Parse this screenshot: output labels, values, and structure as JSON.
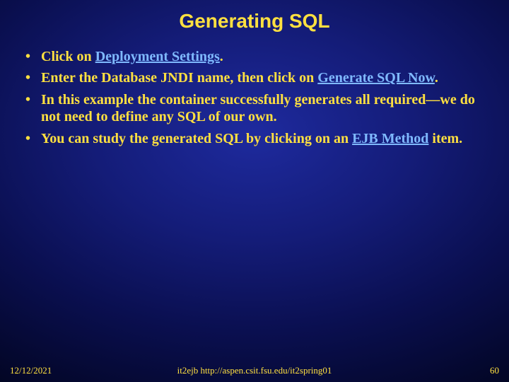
{
  "title": "Generating SQL",
  "bullets": {
    "b1_pre": "Click on ",
    "b1_link": "Deployment Settings",
    "b1_post": ".",
    "b2_pre": "Enter the Database JNDI name, then click on ",
    "b2_link": "Generate SQL Now",
    "b2_post": ".",
    "b3": "In this example the container successfully generates all required—we do not need to define any SQL of our own.",
    "b4_pre": "You can study the generated SQL by clicking on an ",
    "b4_link": "EJB Method",
    "b4_post": " item."
  },
  "footer": {
    "date": "12/12/2021",
    "center": "it2ejb  http://aspen.csit.fsu.edu/it2spring01",
    "page": "60"
  }
}
